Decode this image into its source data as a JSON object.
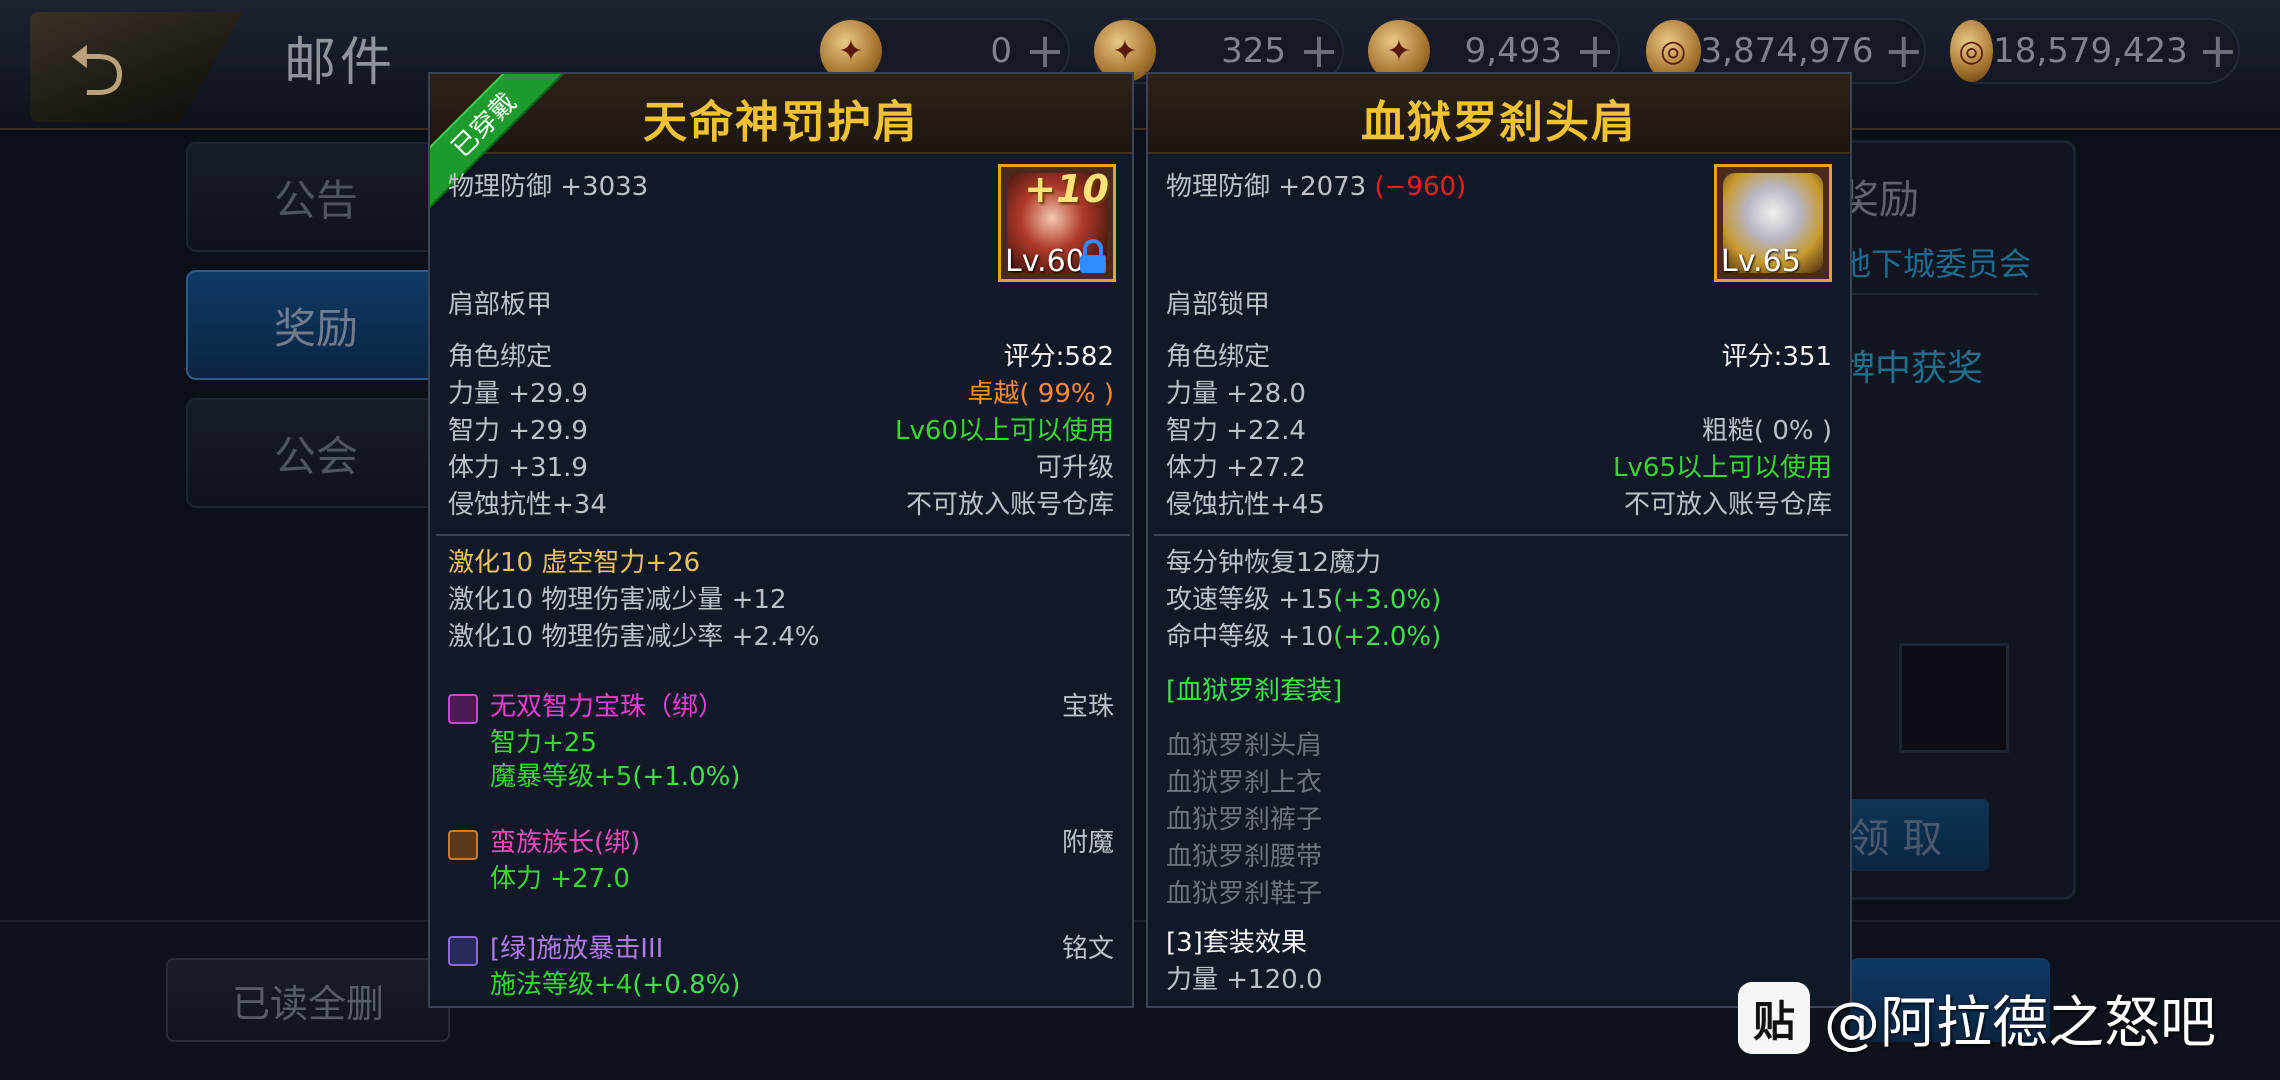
{
  "topbar": {
    "title": "邮件",
    "currencies": [
      {
        "value": "0",
        "icon": "red-scroll-icon"
      },
      {
        "value": "325",
        "icon": "red-scroll-icon"
      },
      {
        "value": "9,493",
        "icon": "red-scroll-icon"
      },
      {
        "value": "3,874,976",
        "icon": "gold-coin-icon"
      },
      {
        "value": "18,579,423",
        "icon": "gold-coin-lock-icon"
      }
    ],
    "plus": "+"
  },
  "tabs": [
    "公告",
    "奖励",
    "公会"
  ],
  "mail_detail": {
    "title": "奖励",
    "sender": "地下城委员会",
    "body": "牌中获奖",
    "claim": "领 取"
  },
  "bottom": {
    "delete_all": "已读全删"
  },
  "left_item": {
    "name": "天命神罚护肩",
    "ribbon": "已穿戴",
    "icon": {
      "plus": "+10",
      "level": "Lv.60"
    },
    "main_stat": "物理防御 +3033",
    "type": "肩部板甲",
    "rows": [
      {
        "l": "角色绑定",
        "r": "评分:582"
      },
      {
        "l": "力量 +29.9",
        "r": "卓越( 99% )"
      },
      {
        "l": "智力 +29.9",
        "r": "Lv60以上可以使用"
      },
      {
        "l": "体力 +31.9",
        "r": "可升级"
      },
      {
        "l": "侵蚀抗性+34",
        "r": "不可放入账号仓库"
      }
    ],
    "amp_lines": [
      "激化10 虚空智力+26",
      "激化10 物理伤害减少量 +12",
      "激化10 物理伤害减少率 +2.4%"
    ],
    "gem": {
      "name": "无双智力宝珠（绑）",
      "tag": "宝珠",
      "stat1": "智力+25",
      "stat2": "魔暴等级+5",
      "stat2b": "(+1.0%)"
    },
    "enchant": {
      "name": "蛮族族长(绑)",
      "tag": "附魔",
      "stat": "体力 +27.0"
    },
    "inscription": {
      "name": "[绿]施放暴击III",
      "tag": "铭文",
      "stat": "施法等级+4",
      "statb": "(+0.8%)"
    }
  },
  "right_item": {
    "name": "血狱罗刹头肩",
    "icon": {
      "level": "Lv.65"
    },
    "main_stat": "物理防御 +2073",
    "main_diff": "(−960)",
    "type": "肩部锁甲",
    "rows": [
      {
        "l": "角色绑定",
        "r": "评分:351"
      },
      {
        "l": "力量 +28.0",
        "r": ""
      },
      {
        "l": "智力 +22.4",
        "r": "粗糙( 0% )"
      },
      {
        "l": "体力 +27.2",
        "r": "Lv65以上可以使用"
      },
      {
        "l": "侵蚀抗性+45",
        "r": "不可放入账号仓库"
      }
    ],
    "extra": [
      {
        "text": "每分钟恢复12魔力",
        "b": ""
      },
      {
        "text": "攻速等级 +15",
        "b": "(+3.0%)"
      },
      {
        "text": "命中等级 +10",
        "b": "(+2.0%)"
      }
    ],
    "set_name": "[血狱罗刹套装]",
    "set_pieces": [
      "血狱罗刹头肩",
      "血狱罗刹上衣",
      "血狱罗刹裤子",
      "血狱罗刹腰带",
      "血狱罗刹鞋子"
    ],
    "set_effect_title": "[3]套装效果",
    "set_effect": "力量 +120.0"
  },
  "watermark": {
    "logo": "贴",
    "text": "@阿拉德之怒吧"
  }
}
